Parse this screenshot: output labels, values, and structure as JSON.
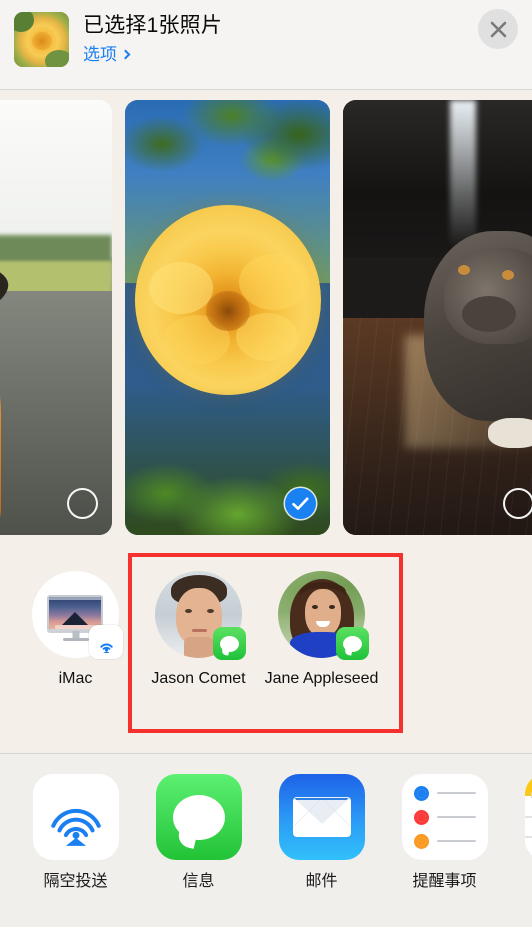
{
  "header": {
    "title": "已选择1张照片",
    "options_label": "选项",
    "options_chevron": "chevron-right-icon",
    "thumbnail_alt": "yellow-rose-photo",
    "close_label": "close-icon"
  },
  "carousel": {
    "photos": [
      {
        "id": "photo-1",
        "alt": "dog-wearing-hat-on-road",
        "selected": false,
        "badge": "unselected-circle"
      },
      {
        "id": "photo-2",
        "alt": "yellow-rose-closeup",
        "selected": true,
        "badge": "selected-checkmark"
      },
      {
        "id": "photo-3",
        "alt": "french-bulldog-on-brick",
        "selected": false,
        "badge": "unselected-circle"
      }
    ]
  },
  "recipients": {
    "items": [
      {
        "name": "iMac",
        "type": "device",
        "badge": "airdrop-icon",
        "avatar": "imac-device-icon",
        "highlighted": false
      },
      {
        "name": "Jason Comet",
        "type": "contact",
        "badge": "messages-icon",
        "avatar": "jason-comet-avatar",
        "highlighted": true
      },
      {
        "name": "Jane Appleseed",
        "type": "contact",
        "badge": "messages-icon",
        "avatar": "jane-appleseed-avatar",
        "highlighted": true
      }
    ],
    "highlight_color": "#f4312f"
  },
  "apps": {
    "items": [
      {
        "label": "隔空投送",
        "icon": "airdrop-icon"
      },
      {
        "label": "信息",
        "icon": "messages-icon"
      },
      {
        "label": "邮件",
        "icon": "mail-icon"
      },
      {
        "label": "提醒事项",
        "icon": "reminders-icon"
      },
      {
        "label": "",
        "icon": "notes-icon"
      }
    ]
  },
  "colors": {
    "accent_blue": "#1a7ff0",
    "selected_blue": "#1a81f2",
    "messages_green": "#22c337",
    "highlight_red": "#f4312f",
    "sheet_bg": "#f1efec",
    "carousel_bg": "#f4f0e9"
  }
}
